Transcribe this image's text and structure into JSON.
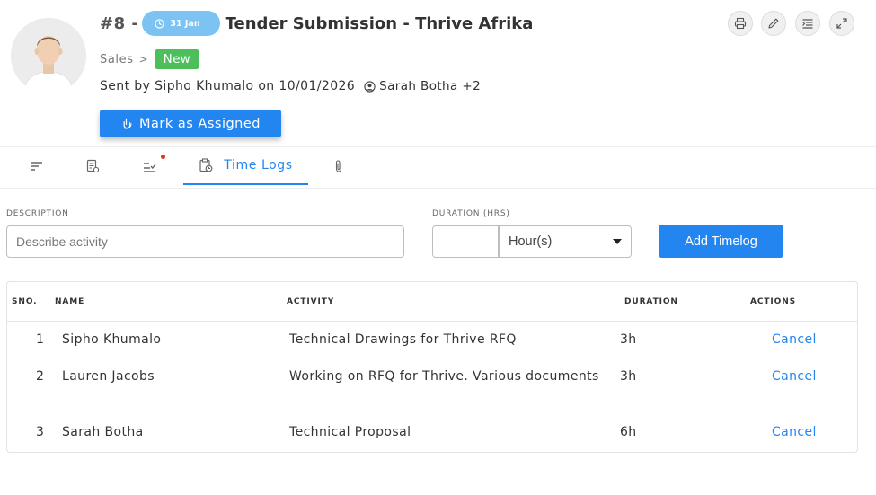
{
  "header": {
    "ticket_no": "#8 -",
    "date_pill": "31 Jan",
    "title": "Tender Submission - Thrive Afrika",
    "breadcrumb": "Sales",
    "breadcrumb_sep": ">",
    "status": "New",
    "sent_line": "Sent by Sipho Khumalo on 10/01/2026",
    "watchers": "Sarah Botha +2",
    "assign_button": "Mark as Assigned",
    "toolbar_icons": [
      "printer-icon",
      "pencil-icon",
      "list-indent-icon",
      "expand-icon"
    ]
  },
  "tabs": [
    {
      "icon": "sort-lines-icon"
    },
    {
      "icon": "document-icon"
    },
    {
      "icon": "checklist-icon",
      "has_dot": true
    },
    {
      "icon": "clipboard-clock-icon",
      "label": "Time Logs",
      "active": true
    },
    {
      "icon": "paperclip-icon"
    }
  ],
  "form": {
    "description_label": "DESCRIPTION",
    "description_placeholder": "Describe activity",
    "duration_label": "DURATION (HRS)",
    "duration_value": "",
    "unit_value": "Hour(s)",
    "add_button": "Add Timelog"
  },
  "table": {
    "columns": [
      "SNO.",
      "NAME",
      "ACTIVITY",
      "DURATION",
      "ACTIONS"
    ],
    "rows": [
      {
        "sno": "1",
        "name": "Sipho Khumalo",
        "activity": "Technical Drawings for Thrive RFQ",
        "duration": "3h",
        "action": "Cancel"
      },
      {
        "sno": "2",
        "name": "Lauren Jacobs",
        "activity": "Working on RFQ for Thrive. Various documents",
        "duration": "3h",
        "action": "Cancel"
      },
      {
        "sno": "3",
        "name": "Sarah Botha",
        "activity": "Technical Proposal",
        "duration": "6h",
        "action": "Cancel"
      }
    ]
  },
  "colors": {
    "accent": "#2386f0",
    "status_new": "#4cbf5a",
    "date_pill": "#7cc3f3",
    "notification_dot": "#e0321e"
  }
}
